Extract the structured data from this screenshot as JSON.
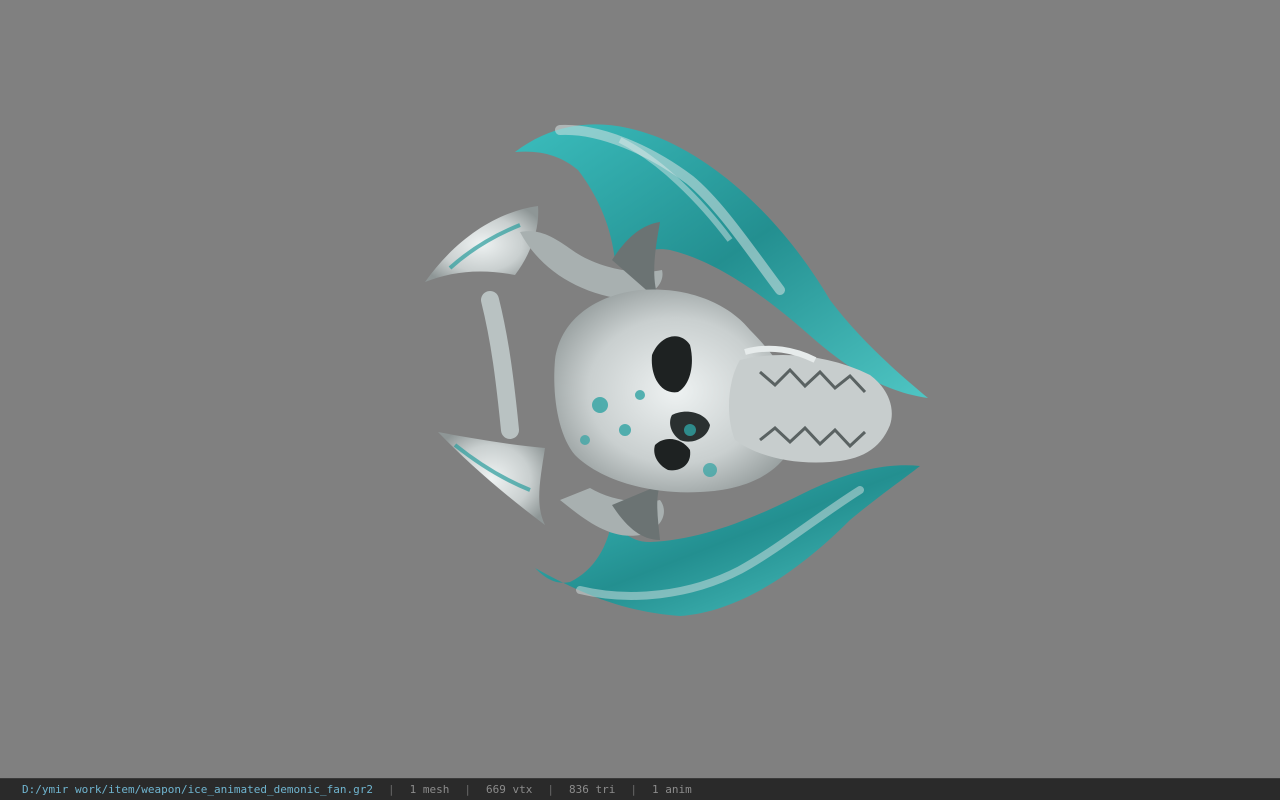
{
  "colors": {
    "background": "#808080",
    "statusbar_bg": "#2a2a2a",
    "path_text": "#6fb4cf",
    "stat_text": "#8c8c8c",
    "model_teal": "#2fa3a3",
    "model_bone": "#d8dcdc"
  },
  "viewport": {
    "model_name": "ice_animated_demonic_fan"
  },
  "statusbar": {
    "file_path": "D:/ymir work/item/weapon/ice_animated_demonic_fan.gr2",
    "separator": "|",
    "mesh_count": "1 mesh",
    "vertex_count": "669 vtx",
    "triangle_count": "836 tri",
    "anim_count": "1 anim"
  }
}
